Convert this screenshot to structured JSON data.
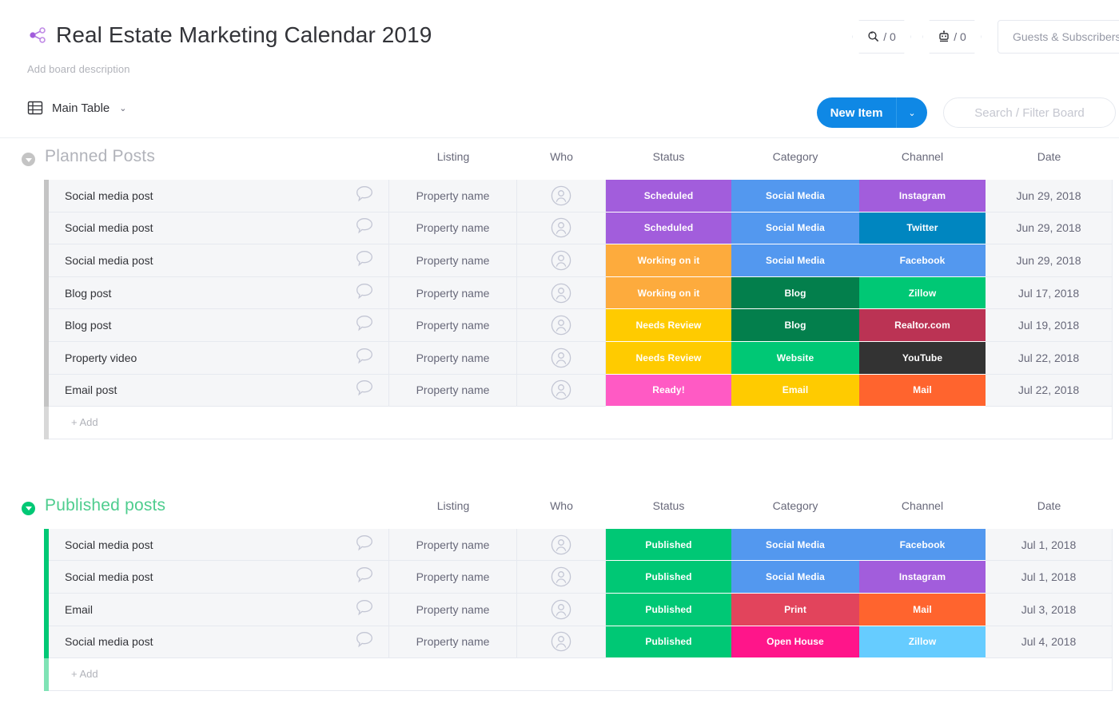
{
  "header": {
    "title": "Real Estate Marketing Calendar 2019",
    "description": "Add board description",
    "share_icon": "share-icon",
    "badges": [
      {
        "icon": "activity-log-icon",
        "count": "/ 0"
      },
      {
        "icon": "automations-robot-icon",
        "count": "/ 0"
      }
    ],
    "guests_label": "Guests & Subscribers"
  },
  "toolbar": {
    "view_icon": "table-view-icon",
    "view_label": "Main Table",
    "view_caret": "⌄",
    "new_item_label": "New Item",
    "new_item_caret": "⌄",
    "new_item_color": "#0f88e5",
    "search_placeholder": "Search / Filter Board"
  },
  "columns": [
    {
      "key": "name",
      "label": ""
    },
    {
      "key": "listing",
      "label": "Listing"
    },
    {
      "key": "who",
      "label": "Who"
    },
    {
      "key": "status",
      "label": "Status"
    },
    {
      "key": "category",
      "label": "Category"
    },
    {
      "key": "channel",
      "label": "Channel"
    },
    {
      "key": "date",
      "label": "Date"
    }
  ],
  "groups": [
    {
      "title": "Planned Posts",
      "color": "#c4c4c4",
      "title_color": "#b1b3ba",
      "add_label": "+ Add",
      "add_bar_color": "#d8d8d8",
      "rows": [
        {
          "name": "Social media post",
          "listing": "Property name",
          "who": "person-avatar-icon",
          "status": "Scheduled",
          "status_color": "#a25ddc",
          "category": "Social Media",
          "category_color": "#5398ef",
          "channel": "Instagram",
          "channel_color": "#a25ddc",
          "date": "Jun 29, 2018"
        },
        {
          "name": "Social media post",
          "listing": "Property name",
          "who": "person-avatar-icon",
          "status": "Scheduled",
          "status_color": "#a25ddc",
          "category": "Social Media",
          "category_color": "#5398ef",
          "channel": "Twitter",
          "channel_color": "#0086c0",
          "date": "Jun 29, 2018"
        },
        {
          "name": "Social media post",
          "listing": "Property name",
          "who": "person-avatar-icon",
          "status": "Working on it",
          "status_color": "#fdab3d",
          "category": "Social Media",
          "category_color": "#5398ef",
          "channel": "Facebook",
          "channel_color": "#5398ef",
          "date": "Jun 29, 2018"
        },
        {
          "name": "Blog post",
          "listing": "Property name",
          "who": "person-avatar-icon",
          "status": "Working on it",
          "status_color": "#fdab3d",
          "category": "Blog",
          "category_color": "#037f4c",
          "channel": "Zillow",
          "channel_color": "#00c875",
          "date": "Jul 17, 2018"
        },
        {
          "name": "Blog post",
          "listing": "Property name",
          "who": "person-avatar-icon",
          "status": "Needs Review",
          "status_color": "#ffcb00",
          "category": "Blog",
          "category_color": "#037f4c",
          "channel": "Realtor.com",
          "channel_color": "#bb3354",
          "date": "Jul 19, 2018"
        },
        {
          "name": "Property video",
          "listing": "Property name",
          "who": "person-avatar-icon",
          "status": "Needs Review",
          "status_color": "#ffcb00",
          "category": "Website",
          "category_color": "#00c875",
          "channel": "YouTube",
          "channel_color": "#333333",
          "date": "Jul 22, 2018"
        },
        {
          "name": "Email post",
          "listing": "Property name",
          "who": "person-avatar-icon",
          "status": "Ready!",
          "status_color": "#ff5ac4",
          "category": "Email",
          "category_color": "#ffcb00",
          "channel": "Mail",
          "channel_color": "#ff642e",
          "date": "Jul 22, 2018"
        }
      ]
    },
    {
      "title": "Published posts",
      "color": "#00c875",
      "title_color": "#4ecd8e",
      "add_label": "+ Add",
      "add_bar_color": "#7fe3b5",
      "rows": [
        {
          "name": "Social media post",
          "listing": "Property name",
          "who": "person-avatar-icon",
          "status": "Published",
          "status_color": "#00c875",
          "category": "Social Media",
          "category_color": "#5398ef",
          "channel": "Facebook",
          "channel_color": "#5398ef",
          "date": "Jul 1, 2018"
        },
        {
          "name": "Social media post",
          "listing": "Property name",
          "who": "person-avatar-icon",
          "status": "Published",
          "status_color": "#00c875",
          "category": "Social Media",
          "category_color": "#5398ef",
          "channel": "Instagram",
          "channel_color": "#a25ddc",
          "date": "Jul 1, 2018"
        },
        {
          "name": "Email",
          "listing": "Property name",
          "who": "person-avatar-icon",
          "status": "Published",
          "status_color": "#00c875",
          "category": "Print",
          "category_color": "#e2445c",
          "channel": "Mail",
          "channel_color": "#ff642e",
          "date": "Jul 3, 2018"
        },
        {
          "name": "Social media post",
          "listing": "Property name",
          "who": "person-avatar-icon",
          "status": "Published",
          "status_color": "#00c875",
          "category": "Open House",
          "category_color": "#ff158a",
          "channel": "Zillow",
          "channel_color": "#66ccff",
          "date": "Jul 4, 2018"
        }
      ]
    }
  ]
}
